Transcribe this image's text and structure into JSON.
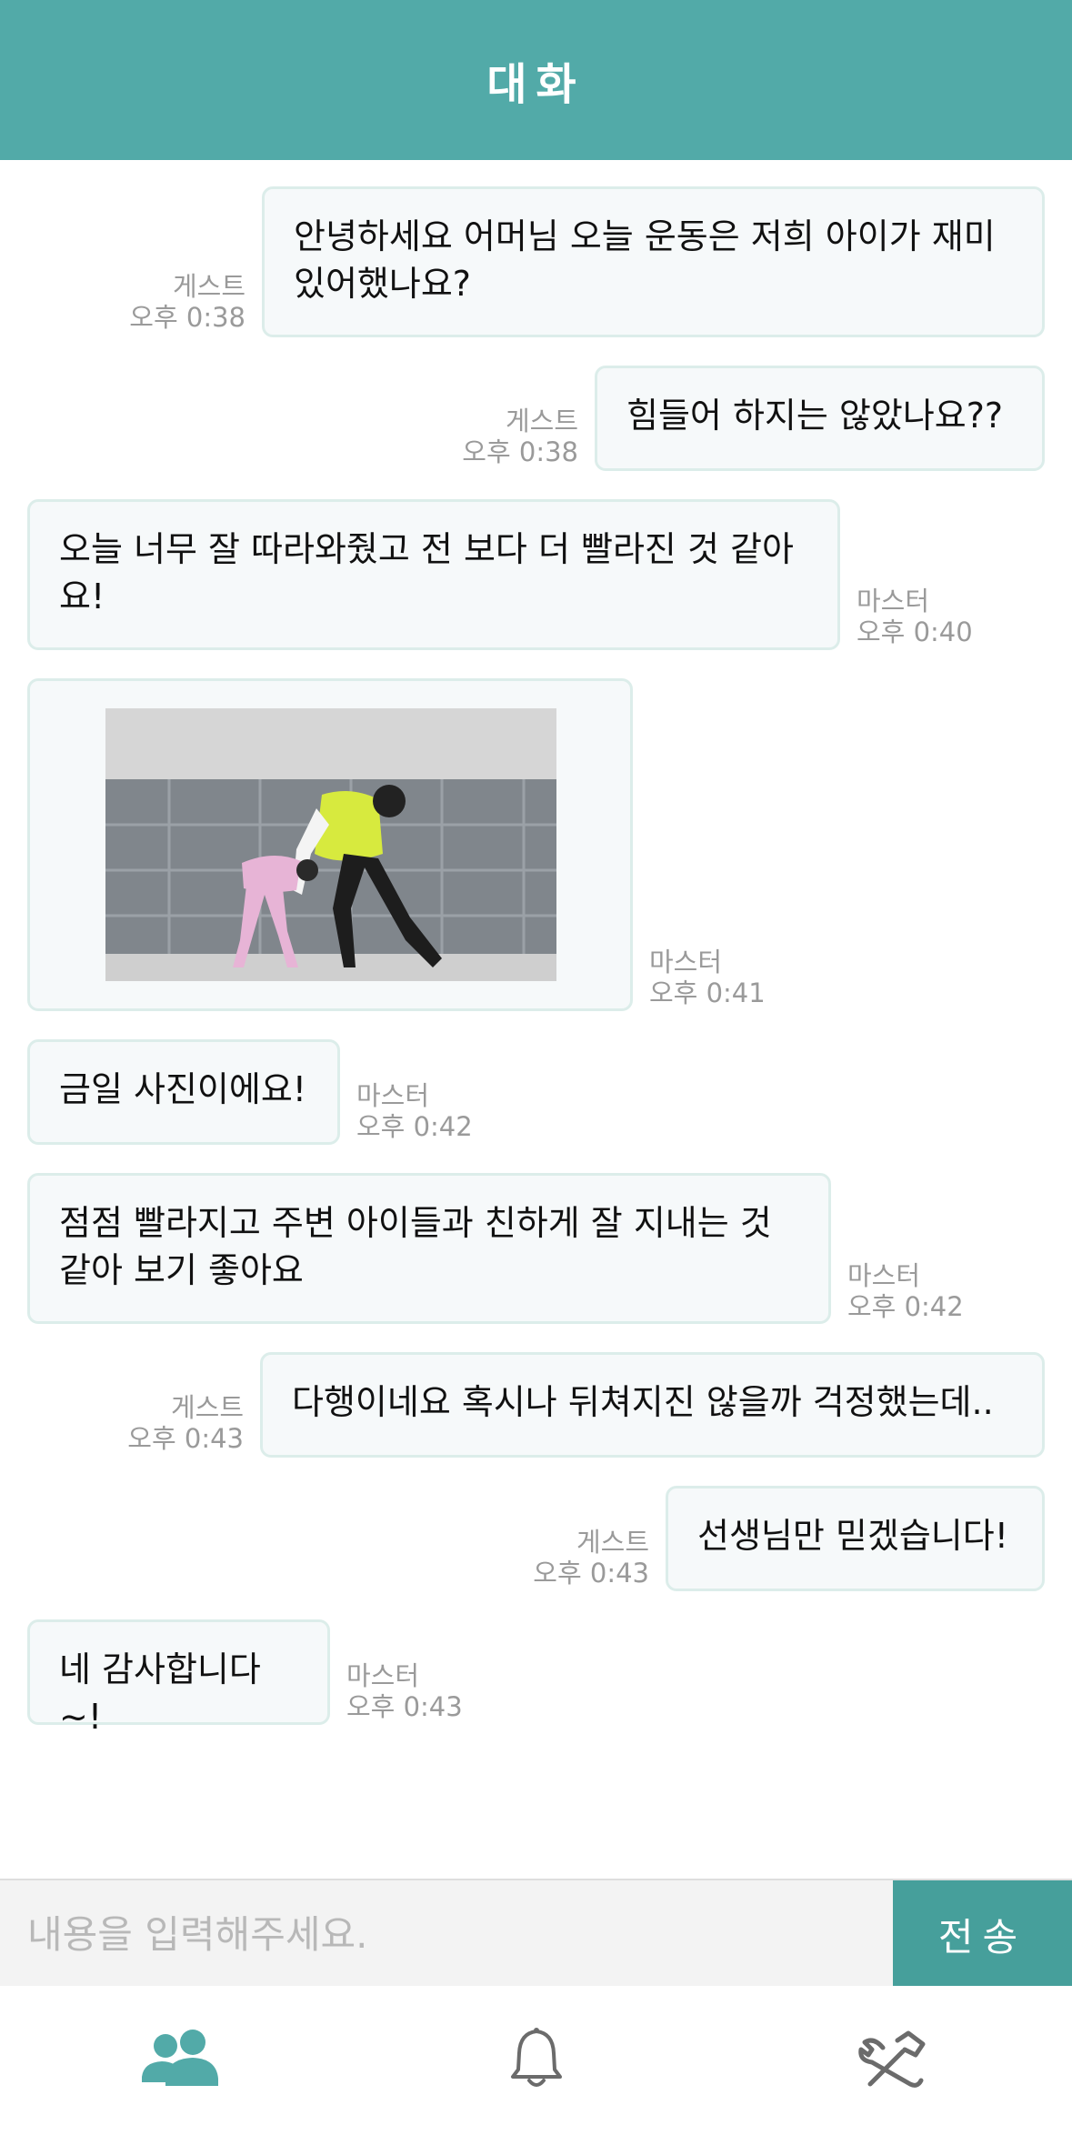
{
  "header": {
    "title": "대화"
  },
  "messages": [
    {
      "id": 1,
      "sender": "게스트",
      "time": "오후 0:38",
      "side": "right",
      "text": "안녕하세요 어머님 오늘 운동은 저희 아이가 재미 있어했나요?"
    },
    {
      "id": 2,
      "sender": "게스트",
      "time": "오후 0:38",
      "side": "right",
      "text": "힘들어 하지는 않았나요??"
    },
    {
      "id": 3,
      "sender": "마스터",
      "time": "오후 0:40",
      "side": "left",
      "text": "오늘 너무 잘 따라와줬고 전 보다 더 빨라진 것 같아요!"
    },
    {
      "id": 4,
      "sender": "마스터",
      "time": "오후 0:41",
      "side": "left",
      "type": "image",
      "image": "exercise-photo"
    },
    {
      "id": 5,
      "sender": "마스터",
      "time": "오후 0:42",
      "side": "left",
      "text": "금일 사진이에요!"
    },
    {
      "id": 6,
      "sender": "마스터",
      "time": "오후 0:42",
      "side": "left",
      "text": "점점 빨라지고 주변 아이들과 친하게 잘 지내는 것 같아 보기 좋아요"
    },
    {
      "id": 7,
      "sender": "게스트",
      "time": "오후 0:43",
      "side": "right",
      "text": "다행이네요 혹시나 뒤쳐지진 않을까 걱정했는데.."
    },
    {
      "id": 8,
      "sender": "게스트",
      "time": "오후 0:43",
      "side": "right",
      "text": "선생님만 믿겠습니다!"
    },
    {
      "id": 9,
      "sender": "마스터",
      "time": "오후 0:43",
      "side": "left",
      "text": "네 감사합니다~!"
    }
  ],
  "input": {
    "placeholder": "내용을 입력해주세요.",
    "value": ""
  },
  "send_button": {
    "label": "전송"
  },
  "nav": {
    "items": [
      {
        "icon": "users-icon",
        "active": true
      },
      {
        "icon": "bell-icon",
        "active": false
      },
      {
        "icon": "tools-icon",
        "active": false
      }
    ]
  },
  "colors": {
    "accent": "#52aaa8",
    "send": "#469f9b",
    "inactive_icon": "#6b6b6b"
  }
}
